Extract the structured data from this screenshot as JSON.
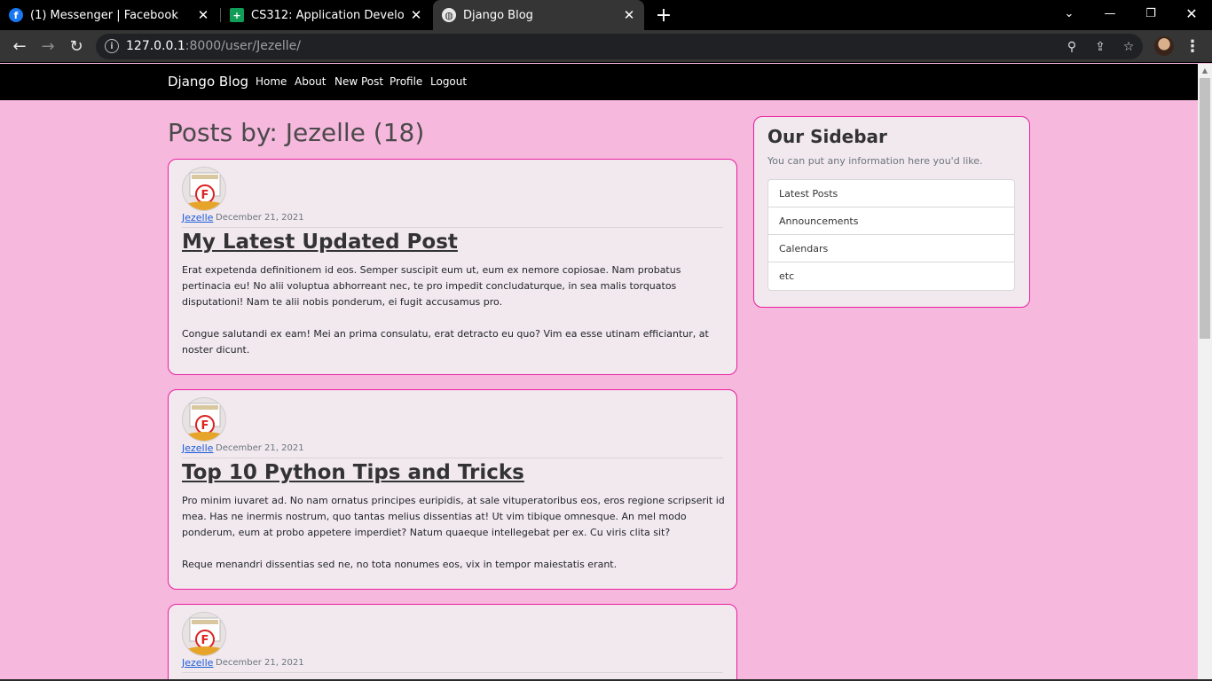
{
  "browser": {
    "tabs": [
      {
        "title": "(1) Messenger | Facebook",
        "icon": "facebook-icon",
        "active": false
      },
      {
        "title": "CS312: Application Development",
        "icon": "sheets-icon",
        "active": false
      },
      {
        "title": "Django Blog",
        "icon": "globe-icon",
        "active": true
      }
    ],
    "url_host": "127.0.0.1",
    "url_path": ":8000/user/Jezelle/"
  },
  "site": {
    "brand": "Django Blog",
    "nav": [
      "Home",
      "About",
      "New Post",
      "Profile",
      "Logout"
    ]
  },
  "page": {
    "heading": "Posts by: Jezelle (18)"
  },
  "posts": [
    {
      "author": "Jezelle",
      "date": "December 21, 2021",
      "title": "My Latest Updated Post",
      "paragraphs": [
        "Erat expetenda definitionem id eos. Semper suscipit eum ut, eum ex nemore copiosae. Nam probatus pertinacia eu! No alii voluptua abhorreant nec, te pro impedit concludaturque, in sea malis torquatos disputationi! Nam te alii nobis ponderum, ei fugit accusamus pro.",
        "Congue salutandi ex eam! Mei an prima consulatu, erat detracto eu quo? Vim ea esse utinam efficiantur, at noster dicunt."
      ]
    },
    {
      "author": "Jezelle",
      "date": "December 21, 2021",
      "title": "Top 10 Python Tips and Tricks",
      "paragraphs": [
        "Pro minim iuvaret ad. No nam ornatus principes euripidis, at sale vituperatoribus eos, eros regione scripserit id mea. Has ne inermis nostrum, quo tantas melius dissentias at! Ut vim tibique omnesque. An mel modo ponderum, eum at probo appetere imperdiet? Natum quaeque intellegebat per ex. Cu viris clita sit?",
        "Reque menandri dissentias sed ne, no tota nonumes eos, vix in tempor maiestatis erant."
      ]
    },
    {
      "author": "Jezelle",
      "date": "December 21, 2021",
      "title": "",
      "paragraphs": []
    }
  ],
  "sidebar": {
    "title": "Our Sidebar",
    "subtitle": "You can put any information here you'd like.",
    "items": [
      "Latest Posts",
      "Announcements",
      "Calendars",
      "etc"
    ]
  }
}
